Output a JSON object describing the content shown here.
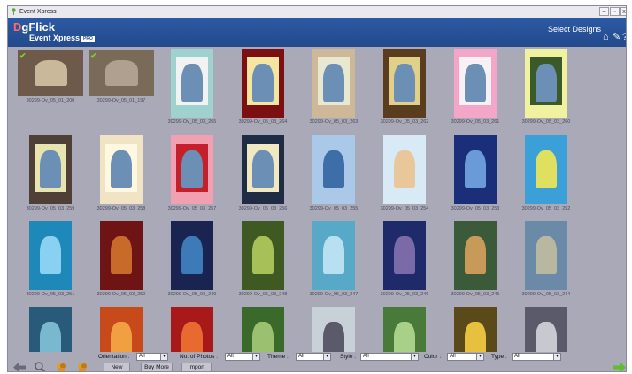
{
  "window": {
    "title": "Event Xpress",
    "controls": [
      "minimize-icon",
      "restore-icon",
      "close-icon"
    ]
  },
  "header": {
    "logo_d": "D",
    "logo_rest": "gFlick",
    "product": "Event Xpress",
    "badge": "PRO",
    "select_designs": "Select Designs",
    "icons": [
      "home-icon",
      "settings-icon",
      "help-icon"
    ]
  },
  "designs": [
    {
      "id": "30299-Ov_05_01_200",
      "bg": "#6e5a4a",
      "frame": "none",
      "fg": "#c9b89a",
      "selected": true
    },
    {
      "id": "30299-Ov_05_01_197",
      "bg": "#7a6a5a",
      "frame": "none",
      "fg": "#b0a090",
      "selected": true
    },
    {
      "id": "30299-Ov_05_03_265",
      "bg": "#9fd1cf",
      "frame": "#f2f2f2",
      "fg": "#6c8fb5",
      "selected": false
    },
    {
      "id": "30299-Ov_05_03_264",
      "bg": "#7b0f12",
      "frame": "#f2e6a0",
      "fg": "#6c8fb5",
      "selected": false
    },
    {
      "id": "30299-Ov_05_03_263",
      "bg": "#cdb89a",
      "frame": "#e8e8d0",
      "fg": "#6c8fb5",
      "selected": false
    },
    {
      "id": "30299-Ov_05_03_262",
      "bg": "#5a3d1e",
      "frame": "#e0d08a",
      "fg": "#6c8fb5",
      "selected": false
    },
    {
      "id": "30299-Ov_05_03_261",
      "bg": "#f4a6c8",
      "frame": "#f7f0f4",
      "fg": "#6c8fb5",
      "selected": false
    },
    {
      "id": "30299-Ov_05_03_260",
      "bg": "#f0f2a0",
      "frame": "#3a5a2a",
      "fg": "#6c8fb5",
      "selected": false
    },
    {
      "id": "30299-Ov_05_03_259",
      "bg": "#4e4037",
      "frame": "#e8e4b0",
      "fg": "#6c8fb5",
      "selected": false
    },
    {
      "id": "30299-Ov_05_03_258",
      "bg": "#f0e4c4",
      "frame": "#fff8e0",
      "fg": "#6c8fb5",
      "selected": false
    },
    {
      "id": "30299-Ov_05_03_257",
      "bg": "#f0a0b0",
      "frame": "#c41f2a",
      "fg": "#6c8fb5",
      "selected": false
    },
    {
      "id": "30299-Ov_05_03_256",
      "bg": "#1e2c44",
      "frame": "#f0e8c0",
      "fg": "#6c8fb5",
      "selected": false
    },
    {
      "id": "30299-Ov_05_03_255",
      "bg": "#aac8e8",
      "frame": "none",
      "fg": "#3e6ea8",
      "selected": false
    },
    {
      "id": "30299-Ov_05_03_254",
      "bg": "#d8eaf6",
      "frame": "none",
      "fg": "#e8c89a",
      "selected": false
    },
    {
      "id": "30299-Ov_05_03_253",
      "bg": "#1a2e7a",
      "frame": "none",
      "fg": "#6a9ad8",
      "selected": false
    },
    {
      "id": "30299-Ov_05_03_252",
      "bg": "#3ca0d8",
      "frame": "none",
      "fg": "#e0e060",
      "selected": false
    },
    {
      "id": "30299-Ov_05_03_251",
      "bg": "#1e88b8",
      "frame": "none",
      "fg": "#8ad0f0",
      "selected": false
    },
    {
      "id": "30299-Ov_05_03_250",
      "bg": "#6e1414",
      "frame": "none",
      "fg": "#c86a2a",
      "selected": false
    },
    {
      "id": "30299-Ov_05_03_249",
      "bg": "#1a2450",
      "frame": "none",
      "fg": "#3c7ab8",
      "selected": false
    },
    {
      "id": "30299-Ov_05_03_248",
      "bg": "#3e5a22",
      "frame": "none",
      "fg": "#a8c058",
      "selected": false
    },
    {
      "id": "30299-Ov_05_03_247",
      "bg": "#58a8c8",
      "frame": "none",
      "fg": "#b8e0f0",
      "selected": false
    },
    {
      "id": "30299-Ov_05_03_246",
      "bg": "#1e2a6a",
      "frame": "none",
      "fg": "#7a6aa8",
      "selected": false
    },
    {
      "id": "30299-Ov_05_03_245",
      "bg": "#3a5a3a",
      "frame": "none",
      "fg": "#c89a5a",
      "selected": false
    },
    {
      "id": "30299-Ov_05_03_244",
      "bg": "#6a8aa8",
      "frame": "none",
      "fg": "#b8b8a0",
      "selected": false
    },
    {
      "id": "",
      "bg": "#2a5a7a",
      "frame": "none",
      "fg": "#7ab8d0",
      "selected": false
    },
    {
      "id": "",
      "bg": "#c84a1a",
      "frame": "none",
      "fg": "#f0a040",
      "selected": false
    },
    {
      "id": "",
      "bg": "#a81a1a",
      "frame": "none",
      "fg": "#e86a30",
      "selected": false
    },
    {
      "id": "",
      "bg": "#3a6a2a",
      "frame": "none",
      "fg": "#9ac070",
      "selected": false
    },
    {
      "id": "",
      "bg": "#c8d0d8",
      "frame": "none",
      "fg": "#5a5a6a",
      "selected": false
    },
    {
      "id": "",
      "bg": "#4a7a3a",
      "frame": "none",
      "fg": "#a8d088",
      "selected": false
    },
    {
      "id": "",
      "bg": "#5a4a1a",
      "frame": "none",
      "fg": "#e8c040",
      "selected": false
    },
    {
      "id": "",
      "bg": "#5a5a6a",
      "frame": "none",
      "fg": "#c8c8d0",
      "selected": false
    }
  ],
  "filters": [
    {
      "label": "Orientation :",
      "value": "All"
    },
    {
      "label": "No. of Photos :",
      "value": "All"
    },
    {
      "label": "Theme :",
      "value": "All"
    },
    {
      "label": "Style :",
      "value": "All"
    },
    {
      "label": "Color :",
      "value": "All"
    },
    {
      "label": "Type :",
      "value": "All"
    }
  ],
  "buttons": {
    "new": "New",
    "buy_more": "Buy More",
    "import": "Import"
  },
  "bottom_icons": [
    "back-arrow-icon",
    "zoom-icon",
    "add-photo-icon",
    "remove-photo-icon",
    "next-arrow-icon"
  ],
  "colors": {
    "header_blue": "#234a8c",
    "grid_bg": "#a9a9b8",
    "next_green": "#5cc02a"
  }
}
